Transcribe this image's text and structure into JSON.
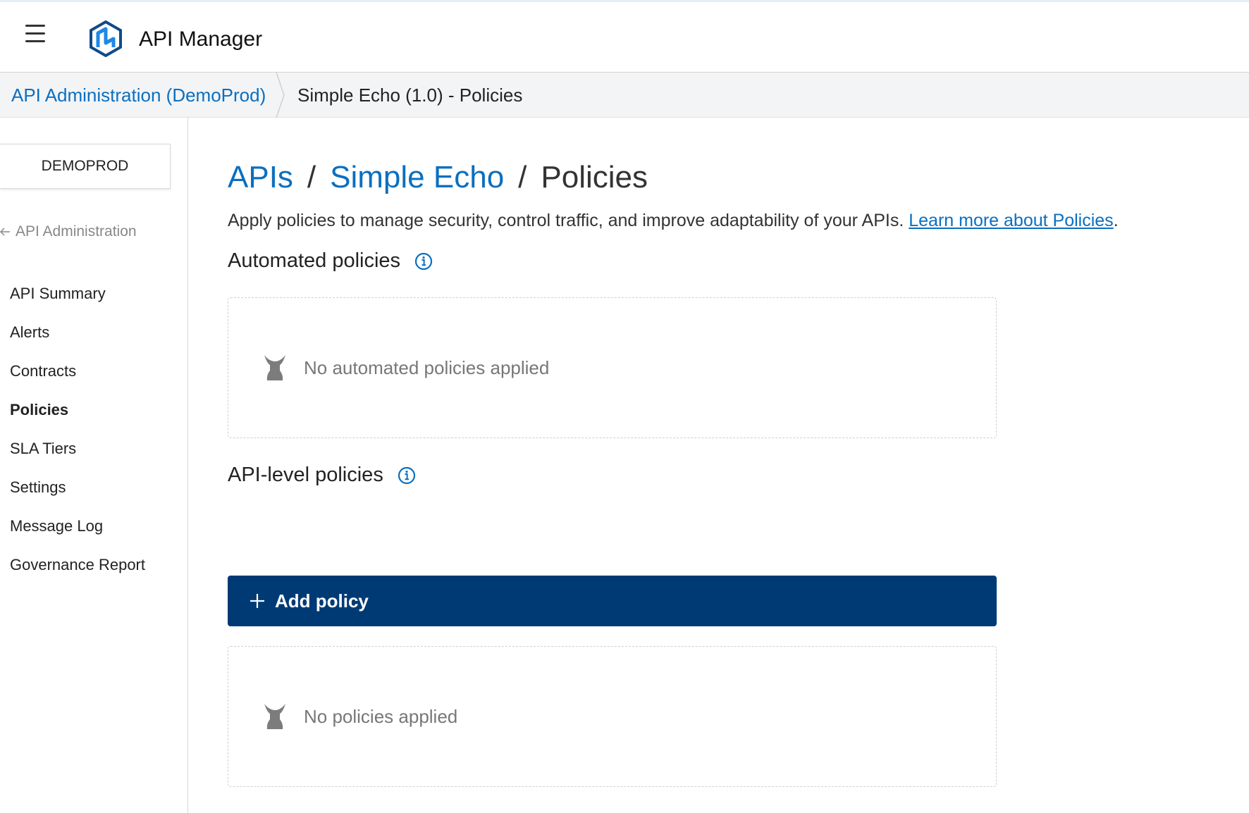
{
  "header": {
    "app_title": "API Manager",
    "menu_icon": "hamburger-icon",
    "logo_icon": "mulesoft-logo-icon"
  },
  "breadcrumb": {
    "parent": "API Administration (DemoProd)",
    "current": "Simple Echo (1.0) - Policies"
  },
  "sidebar": {
    "environment": "DEMOPROD",
    "back_label": "API Administration",
    "items": [
      {
        "label": "API Summary",
        "active": false
      },
      {
        "label": "Alerts",
        "active": false
      },
      {
        "label": "Contracts",
        "active": false
      },
      {
        "label": "Policies",
        "active": true
      },
      {
        "label": "SLA Tiers",
        "active": false
      },
      {
        "label": "Settings",
        "active": false
      },
      {
        "label": "Message Log",
        "active": false
      },
      {
        "label": "Governance Report",
        "active": false
      }
    ]
  },
  "main": {
    "heading": {
      "apis": "APIs",
      "api_name": "Simple Echo",
      "current": "Policies",
      "separator": "/"
    },
    "description": "Apply policies to manage security, control traffic, and improve adaptability of your APIs.",
    "learn_more": "Learn more about Policies",
    "description_end": ".",
    "automated": {
      "title": "Automated policies",
      "empty_message": "No automated policies applied"
    },
    "api_level": {
      "title": "API-level policies",
      "add_button": "Add policy",
      "empty_message": "No policies applied"
    }
  },
  "colors": {
    "link": "#0b6fbf",
    "primary_button": "#003a75",
    "empty_text": "#777777"
  }
}
